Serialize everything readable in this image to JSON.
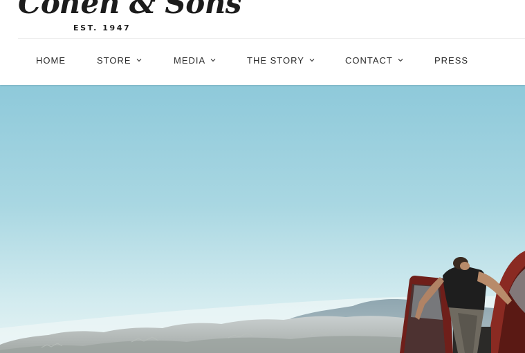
{
  "brand": {
    "name": "Cohen & Sons",
    "established": "EST. 1947"
  },
  "nav": {
    "items": [
      {
        "label": "HOME",
        "icon": null
      },
      {
        "label": "STORE",
        "icon": "chevron-down-icon"
      },
      {
        "label": "MEDIA",
        "icon": "chevron-down-icon"
      },
      {
        "label": "THE STORY",
        "icon": "chevron-down-icon"
      },
      {
        "label": "CONTACT",
        "icon": "chevron-down-icon"
      },
      {
        "label": "PRESS",
        "icon": null
      }
    ]
  },
  "colors": {
    "text": "#2b2b2b",
    "logo": "#1c1c1c",
    "sky_top": "#8ec9da",
    "sky_bottom": "#e2f1f3",
    "truck_red": "#8a2a22"
  }
}
